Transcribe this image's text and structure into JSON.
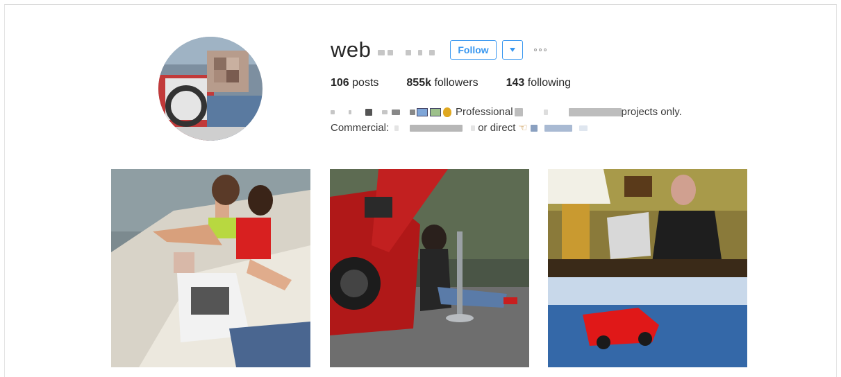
{
  "profile": {
    "username": "web",
    "follow_label": "Follow",
    "dropdown_icon": "caret-down-icon",
    "more_icon": "more-options-icon",
    "stats": {
      "posts_count": "106",
      "posts_label": "posts",
      "followers_count": "855k",
      "followers_label": "followers",
      "following_count": "143",
      "following_label": "following"
    },
    "bio": {
      "line1_a": "Professional",
      "line1_b": "projects only.",
      "line2_a": "Commercial:",
      "line2_b": "or direct"
    }
  },
  "colors": {
    "accent": "#3897f0",
    "text": "#262626",
    "muted": "#999999"
  },
  "posts": [
    {
      "alt": "photo-boat-group"
    },
    {
      "alt": "photo-red-sports-car-hookah"
    },
    {
      "alt": "photo-laptop-and-red-convertible"
    }
  ]
}
